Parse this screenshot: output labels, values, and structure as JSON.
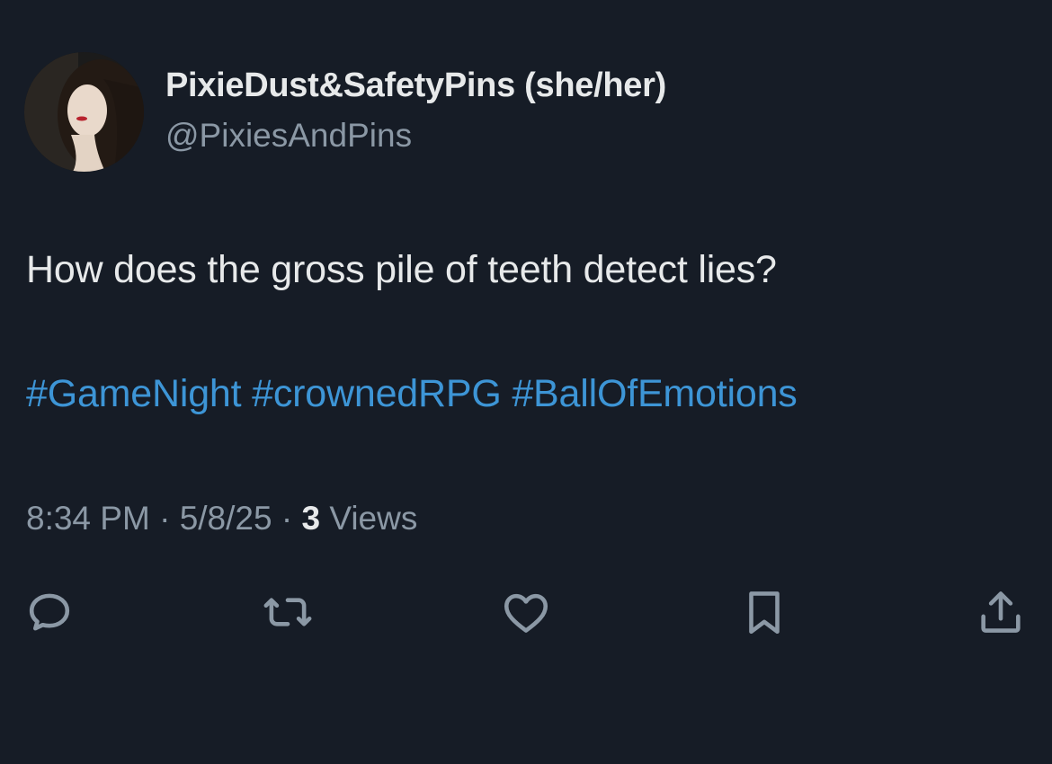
{
  "author": {
    "display_name": "PixieDust&SafetyPins (she/her)",
    "handle": "@PixiesAndPins",
    "avatar_icon": "profile-photo"
  },
  "tweet": {
    "text": "How does the gross pile of teeth detect lies?",
    "hashtags": [
      "#GameNight",
      "#crownedRPG",
      "#BallOfEmotions"
    ],
    "time": "8:34 PM",
    "separator": "·",
    "date": "5/8/25",
    "views_count": "3",
    "views_label": "Views"
  },
  "actions": [
    {
      "name": "reply",
      "icon": "reply-icon"
    },
    {
      "name": "retweet",
      "icon": "retweet-icon"
    },
    {
      "name": "like",
      "icon": "heart-icon"
    },
    {
      "name": "bookmark",
      "icon": "bookmark-icon"
    },
    {
      "name": "share",
      "icon": "share-icon"
    }
  ],
  "colors": {
    "background": "#161c26",
    "text": "#e7e9ea",
    "secondary": "#8b98a5",
    "hashtag": "#3d95d6"
  }
}
